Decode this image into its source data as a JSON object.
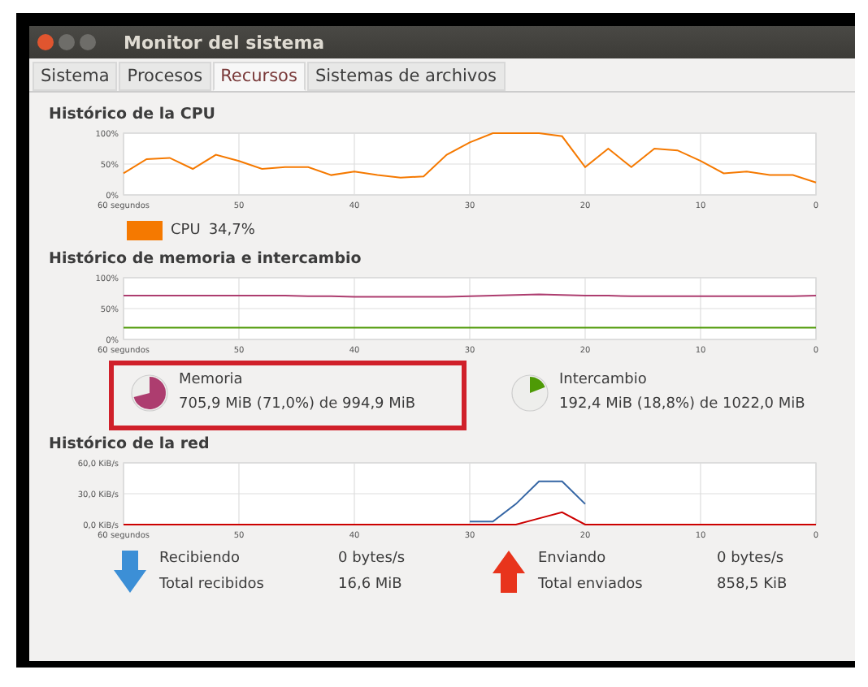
{
  "window": {
    "title": "Monitor del sistema"
  },
  "tabs": [
    {
      "label": "Sistema",
      "selected": false
    },
    {
      "label": "Procesos",
      "selected": false
    },
    {
      "label": "Recursos",
      "selected": true
    },
    {
      "label": "Sistemas de archivos",
      "selected": false
    }
  ],
  "cpu": {
    "title": "Histórico de la CPU",
    "chart_data": {
      "type": "line",
      "grid": true,
      "x": [
        60,
        58,
        56,
        54,
        52,
        50,
        48,
        46,
        44,
        42,
        40,
        38,
        36,
        34,
        32,
        30,
        28,
        26,
        24,
        22,
        20,
        18,
        16,
        14,
        12,
        10,
        8,
        6,
        4,
        2,
        0
      ],
      "xlim": [
        60,
        0
      ],
      "ylim": [
        0,
        100
      ],
      "xticks": [
        {
          "value": 60,
          "label": "60 segundos"
        },
        50,
        40,
        30,
        20,
        10,
        0
      ],
      "yticks": [
        {
          "value": 0,
          "label": "0%"
        },
        {
          "value": 50,
          "label": "50%"
        },
        {
          "value": 100,
          "label": "100%"
        }
      ],
      "series": [
        {
          "name": "CPU",
          "color": "#f57900",
          "values": [
            35,
            58,
            60,
            42,
            65,
            55,
            42,
            45,
            45,
            32,
            38,
            32,
            28,
            30,
            65,
            85,
            100,
            100,
            100,
            95,
            45,
            75,
            45,
            75,
            72,
            55,
            35,
            38,
            32,
            32,
            20
          ]
        }
      ]
    },
    "legend": [
      {
        "value": "34,7%"
      }
    ]
  },
  "memory": {
    "title": "Histórico de memoria e intercambio",
    "chart_data": {
      "type": "line",
      "grid": true,
      "x": [
        60,
        58,
        56,
        54,
        52,
        50,
        48,
        46,
        44,
        42,
        40,
        38,
        36,
        34,
        32,
        30,
        28,
        26,
        24,
        22,
        20,
        18,
        16,
        14,
        12,
        10,
        8,
        6,
        4,
        2,
        0
      ],
      "xlim": [
        60,
        0
      ],
      "ylim": [
        0,
        100
      ],
      "xticks": [
        {
          "value": 60,
          "label": "60 segundos"
        },
        50,
        40,
        30,
        20,
        10,
        0
      ],
      "yticks": [
        {
          "value": 0,
          "label": "0%"
        },
        {
          "value": 50,
          "label": "50%"
        },
        {
          "value": 100,
          "label": "100%"
        }
      ],
      "series": [
        {
          "name": "Memoria",
          "color": "#ad3d6f",
          "values": [
            71,
            71,
            71,
            71,
            71,
            71,
            71,
            71,
            70,
            70,
            69,
            69,
            69,
            69,
            69,
            70,
            71,
            72,
            73,
            72,
            71,
            71,
            70,
            70,
            70,
            70,
            70,
            70,
            70,
            70,
            71
          ]
        },
        {
          "name": "Intercambio",
          "color": "#4e9a06",
          "values": [
            19,
            19,
            19,
            19,
            19,
            19,
            19,
            19,
            19,
            19,
            19,
            19,
            19,
            19,
            19,
            19,
            19,
            19,
            19,
            19,
            19,
            19,
            19,
            19,
            19,
            19,
            19,
            19,
            19,
            19,
            19
          ]
        }
      ]
    },
    "legend": [
      {
        "value": "705,9 MiB (71,0%) de 994,9 MiB"
      },
      {
        "value": "192,4 MiB (18,8%) de 1022,0 MiB"
      }
    ]
  },
  "network": {
    "title": "Histórico de la red",
    "chart_data": {
      "type": "line",
      "grid": true,
      "x": [
        60,
        58,
        56,
        54,
        52,
        50,
        48,
        46,
        44,
        42,
        40,
        38,
        36,
        34,
        32,
        30,
        28,
        26,
        24,
        22,
        20,
        18,
        16,
        14,
        12,
        10,
        8,
        6,
        4,
        2,
        0
      ],
      "xlim": [
        60,
        0
      ],
      "ylim": [
        0,
        60
      ],
      "xticks": [
        {
          "value": 60,
          "label": "60 segundos"
        },
        50,
        40,
        30,
        20,
        10,
        0
      ],
      "yticks": [
        {
          "value": 0,
          "label": "0,0 KiB/s"
        },
        {
          "value": 30,
          "label": "30,0 KiB/s"
        },
        {
          "value": 60,
          "label": "60,0 KiB/s"
        }
      ],
      "series": [
        {
          "name": "Recibiendo",
          "color": "#3465a4",
          "values": [
            null,
            null,
            null,
            null,
            null,
            null,
            null,
            null,
            null,
            null,
            null,
            null,
            null,
            null,
            null,
            3,
            3,
            20,
            42,
            42,
            20,
            null,
            null,
            null,
            null,
            null,
            null,
            null,
            null,
            null,
            null
          ]
        },
        {
          "name": "Enviando",
          "color": "#cc0000",
          "values": [
            0,
            0,
            0,
            0,
            0,
            0,
            0,
            0,
            0,
            0,
            0,
            0,
            0,
            0,
            0,
            0,
            0,
            0,
            6,
            12,
            0,
            0,
            0,
            0,
            0,
            0,
            0,
            0,
            0,
            0,
            0
          ]
        }
      ]
    },
    "legend": [
      {
        "kind": "receive",
        "rate": "0 bytes/s",
        "total_label": "Total recibidos",
        "total": "16,6 MiB"
      },
      {
        "kind": "send",
        "rate": "0 bytes/s",
        "total_label": "Total enviados",
        "total": "858,5 KiB"
      }
    ]
  }
}
